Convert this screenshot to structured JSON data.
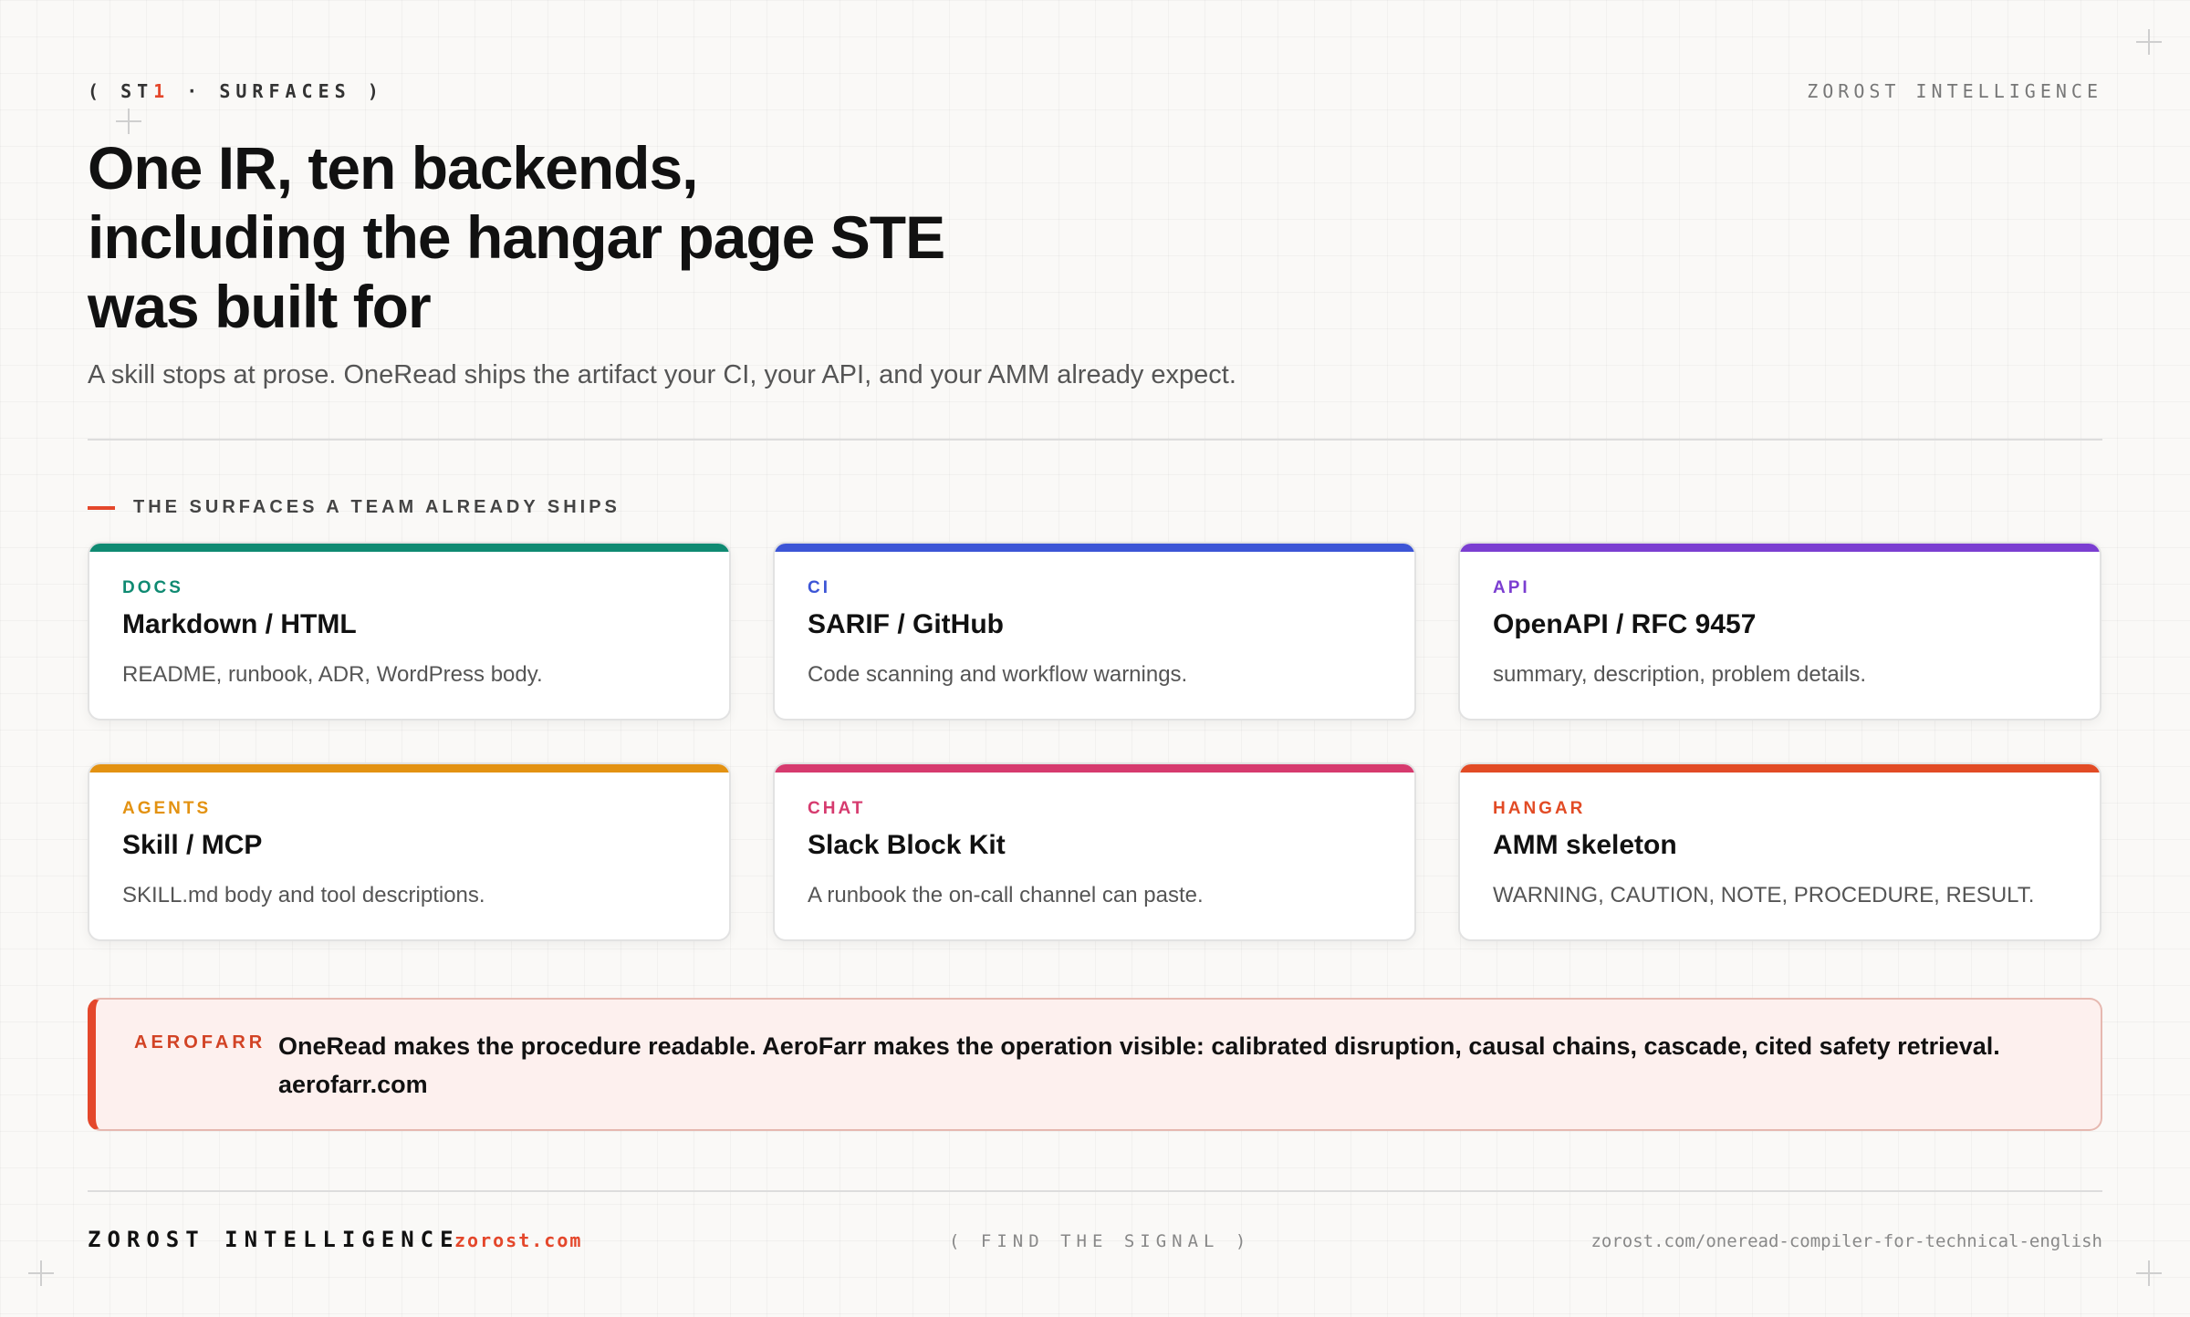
{
  "header": {
    "eyebrow_open": "( ST",
    "eyebrow_accent": "1",
    "eyebrow_rest": " · SURFACES )",
    "brand": "ZOROST INTELLIGENCE",
    "headline_line1": "One IR, ten backends,",
    "headline_line2": "including the hangar page STE",
    "headline_line3": "was built for",
    "subhead": "A skill stops at prose. OneRead ships the artifact your CI, your API, and your AMM already expect."
  },
  "section": {
    "label": "THE SURFACES A TEAM ALREADY SHIPS"
  },
  "cards": [
    {
      "tag": "DOCS",
      "title": "Markdown / HTML",
      "desc": "README, runbook, ADR, WordPress body.",
      "color": "#0f8a72"
    },
    {
      "tag": "CI",
      "title": "SARIF / GitHub",
      "desc": "Code scanning and workflow warnings.",
      "color": "#3c55d6"
    },
    {
      "tag": "API",
      "title": "OpenAPI / RFC 9457",
      "desc": "summary, description, problem details.",
      "color": "#7b3ed1"
    },
    {
      "tag": "AGENTS",
      "title": "Skill / MCP",
      "desc": "SKILL.md body and tool descriptions.",
      "color": "#e39212"
    },
    {
      "tag": "CHAT",
      "title": "Slack Block Kit",
      "desc": "A runbook the on-call channel can paste.",
      "color": "#d63a6e"
    },
    {
      "tag": "HANGAR",
      "title": "AMM skeleton",
      "desc": "WARNING, CAUTION, NOTE, PROCEDURE, RESULT.",
      "color": "#e24b25"
    }
  ],
  "callout": {
    "tag": "AEROFARR",
    "message": "OneRead makes the procedure readable. AeroFarr makes the operation visible: calibrated disruption, causal chains, cascade, cited safety retrieval.",
    "link": "aerofarr.com"
  },
  "footer": {
    "brand": "ZOROST INTELLIGENCE",
    "url": "zorost.com",
    "tagline": "( FIND THE SIGNAL )",
    "path": "zorost.com/oneread-compiler-for-technical-english"
  },
  "colors": {
    "accent": "#e4472b",
    "background": "#faf9f7"
  },
  "icons": [
    "crosshair-icon"
  ]
}
